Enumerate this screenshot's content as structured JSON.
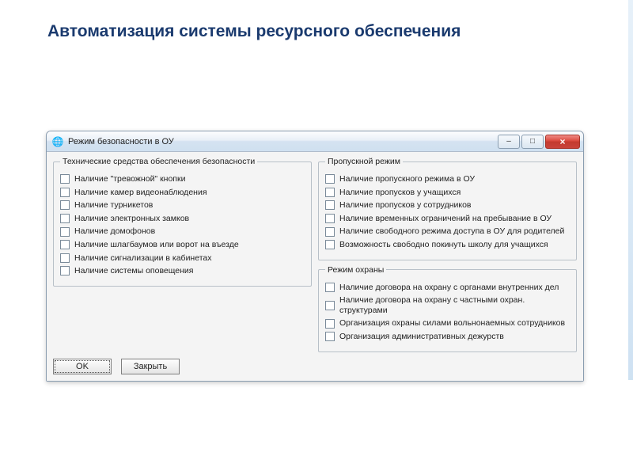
{
  "page": {
    "title": "Автоматизация системы  ресурсного обеспечения"
  },
  "window": {
    "title": "Режим безопасности в ОУ",
    "icon": "🌐",
    "controls": {
      "minimize": "–",
      "maximize": "□",
      "close": "×"
    }
  },
  "groups": {
    "tech": {
      "legend": "Технические средства обеспечения безопасности",
      "items": [
        "Наличие \"тревожной\" кнопки",
        "Наличие камер видеонаблюдения",
        "Наличие турникетов",
        "Наличие электронных замков",
        "Наличие домофонов",
        "Наличие шлагбаумов или ворот на въезде",
        "Наличие сигнализации в кабинетах",
        "Наличие системы оповещения"
      ]
    },
    "access": {
      "legend": "Пропускной режим",
      "items": [
        "Наличие пропускного режима в ОУ",
        "Наличие пропусков у учащихся",
        "Наличие пропусков у сотрудников",
        "Наличие временных ограничений на пребывание в ОУ",
        "Наличие свободного режима доступа в ОУ для родителей",
        "Возможность свободно покинуть школу для учащихся"
      ]
    },
    "guard": {
      "legend": "Режим охраны",
      "items": [
        "Наличие договора на охрану с органами внутренних дел",
        "Наличие договора на охрану с частными охран. структурами",
        "Организация охраны силами вольнонаемных сотрудников",
        "Организация административных дежурств"
      ]
    }
  },
  "buttons": {
    "ok": "OK",
    "close": "Закрыть"
  }
}
